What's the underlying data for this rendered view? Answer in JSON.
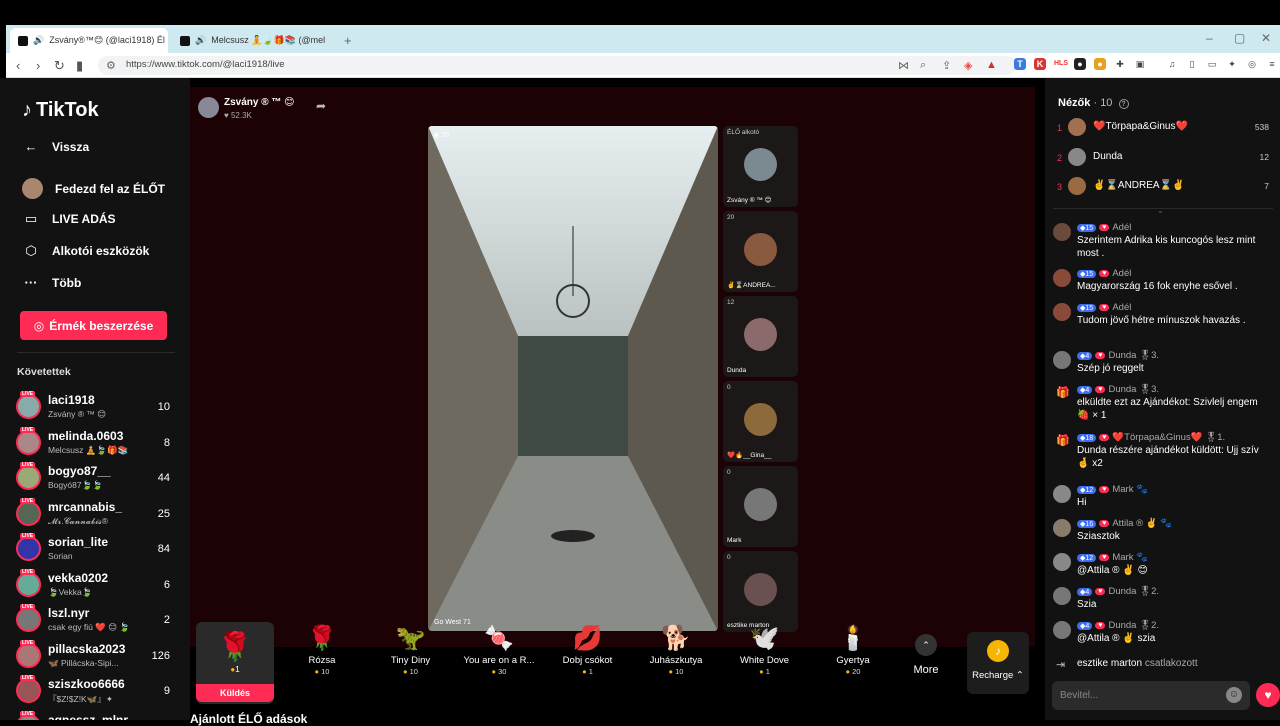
{
  "browser": {
    "tabs": [
      {
        "title": "Zsvány®™😊 (@laci1918) Él",
        "active": true
      },
      {
        "title": "Melcsusz 🧘🍃🎁📚 (@mel",
        "active": false
      }
    ],
    "new_tab": "+",
    "url": "https://www.tiktok.com/@laci1918/live"
  },
  "sidebar": {
    "logo": "TikTok",
    "menu": [
      {
        "label": "Vissza",
        "icon": "←"
      },
      {
        "label": "Fedezd fel az ÉLŐT",
        "icon": "avatar"
      },
      {
        "label": "LIVE ADÁS",
        "icon": "▭"
      },
      {
        "label": "Alkotói eszközök",
        "icon": "⬡"
      },
      {
        "label": "Több",
        "icon": "···"
      }
    ],
    "coin_button": "Érmék beszerzése",
    "following_title": "Követettek",
    "following": [
      {
        "name": "laci1918",
        "sub": "Zsvány ® ™ 😊",
        "count": "10",
        "color": "#8aa"
      },
      {
        "name": "melinda.0603",
        "sub": "Melcsusz 🧘🍃🎁📚",
        "count": "8",
        "color": "#a88"
      },
      {
        "name": "bogyo87__",
        "sub": "Bogyó87🍃🍃",
        "count": "44",
        "color": "#9a7"
      },
      {
        "name": "mrcannabis_",
        "sub": "𝓜𝓻.𝓒𝓪𝓷𝓷𝓪𝓫𝓲𝓼®",
        "count": "25",
        "color": "#565"
      },
      {
        "name": "sorian_lite",
        "sub": "Sorian",
        "count": "84",
        "color": "#33a"
      },
      {
        "name": "vekka0202",
        "sub": "🍃Vekka🍃",
        "count": "6",
        "color": "#6a9"
      },
      {
        "name": "lszl.nyr",
        "sub": "csak egy fiú ❤️ 😊 🍃",
        "count": "2",
        "color": "#777"
      },
      {
        "name": "pillacska2023",
        "sub": "🦋 Pillácska-Sipi...",
        "count": "126",
        "color": "#a77"
      },
      {
        "name": "sziszkoo6666",
        "sub": "『$Z!$Z!K🦋』✦",
        "count": "9",
        "color": "#955"
      },
      {
        "name": "agnessz_mlnr",
        "sub": "",
        "count": "",
        "color": "#888"
      }
    ]
  },
  "stream": {
    "host_name": "Zsvány ® ™ 😊",
    "host_likes": "52.3K",
    "main_viewers": "20",
    "main_label": "Go West 71",
    "guests": [
      {
        "count": "ÉLŐ alkotó",
        "name": "Zsvány ® ™ 😊"
      },
      {
        "count": "20",
        "name": "✌️⌛ANDREA..."
      },
      {
        "count": "12",
        "name": "Dunda"
      },
      {
        "count": "0",
        "name": "❤️🔥__Gina__"
      },
      {
        "count": "0",
        "name": "Mark"
      },
      {
        "count": "0",
        "name": "esztike marton"
      }
    ]
  },
  "gifts": {
    "selected": {
      "icon": "🌹",
      "price": "1",
      "send_label": "Küldés"
    },
    "items": [
      {
        "name": "Rózsa",
        "price": "10",
        "icon": "🌹"
      },
      {
        "name": "Tiny Diny",
        "price": "10",
        "icon": "🦖"
      },
      {
        "name": "You are on a R...",
        "price": "30",
        "icon": "🍬"
      },
      {
        "name": "Dobj csókot",
        "price": "1",
        "icon": "💋"
      },
      {
        "name": "Juhászkutya",
        "price": "10",
        "icon": "🐕"
      },
      {
        "name": "White Dove",
        "price": "1",
        "icon": "🕊️"
      },
      {
        "name": "Gyertya",
        "price": "20",
        "icon": "🕯️"
      }
    ],
    "more_label": "More",
    "recharge_label": "Recharge ⌃"
  },
  "bottom_title": "Ajánlott ÉLŐ adások",
  "viewers": {
    "title": "Nézők",
    "count": "· 10",
    "top": [
      {
        "rank": "1",
        "name": "❤️Törpapa&Ginus❤️",
        "score": "538"
      },
      {
        "rank": "2",
        "name": "Dunda",
        "score": "12"
      },
      {
        "rank": "3",
        "name": "✌️⌛ANDREA⌛✌️",
        "score": "7"
      }
    ]
  },
  "chat": {
    "messages": [
      {
        "lvl": "15",
        "user": "Adél",
        "text": "Szerintem Adrika kis kuncogós lesz mint most ."
      },
      {
        "lvl": "15",
        "user": "Adél",
        "text": "Magyarország 16 fok enyhe esővel ."
      },
      {
        "lvl": "15",
        "user": "Adél",
        "text": "Tudom jövő hétre mínuszok havazás ."
      },
      {
        "lvl": "4",
        "user": "Dunda 🎖3.",
        "text": "Szép jó reggelt"
      },
      {
        "lvl": "4",
        "user": "Dunda 🎖3.",
        "text": "elküldte ezt az Ajándékot: Szivlelj engem 🍓 × 1"
      },
      {
        "lvl": "18",
        "user": "❤️Törpapa&Ginus❤️ 🎖1.",
        "text": "Dunda részére ajándékot küldött: Ujj szív 🤞 x2"
      },
      {
        "lvl": "12",
        "user": "Mark 🐾",
        "text": "Hi"
      },
      {
        "lvl": "16",
        "user": "Attila ® ✌️ 🐾",
        "text": "Sziasztok"
      },
      {
        "lvl": "12",
        "user": "Mark 🐾",
        "text": "@Attila ® ✌️ 😊"
      },
      {
        "lvl": "4",
        "user": "Dunda 🎖2.",
        "text": "Szia"
      },
      {
        "lvl": "4",
        "user": "Dunda 🎖2.",
        "text": "@Attila ® ✌️ szia"
      }
    ],
    "joined_user": "esztike marton",
    "joined_text": "csatlakozott",
    "input_placeholder": "Bevitel..."
  }
}
